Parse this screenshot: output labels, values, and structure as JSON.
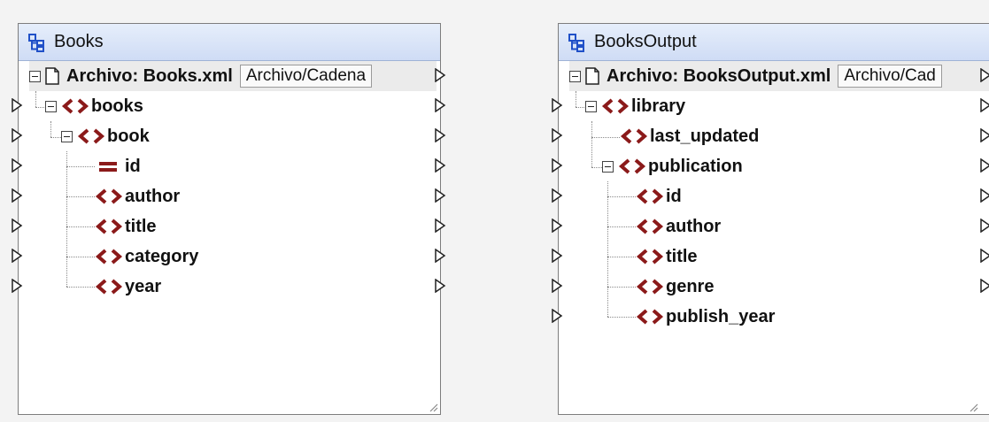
{
  "components": [
    {
      "id": "books",
      "title": "Books",
      "file_label": "Archivo: Books.xml",
      "file_button": "Archivo/Cadena",
      "nodes": [
        "books",
        "book",
        "id",
        "author",
        "title",
        "category",
        "year"
      ]
    },
    {
      "id": "output",
      "title": "BooksOutput",
      "file_label": "Archivo: BooksOutput.xml",
      "file_button": "Archivo/Cad",
      "nodes": [
        "library",
        "last_updated",
        "publication",
        "id",
        "author",
        "title",
        "genre",
        "publish_year"
      ]
    }
  ],
  "icons": {
    "component": "structure-tree-icon",
    "element": "xml-element-icon",
    "attribute": "xml-attribute-icon",
    "file": "document-icon",
    "port": "connector-triangle-icon"
  },
  "colors": {
    "element_icon": "#8b1a1a",
    "header_bg": "#d6e2f7",
    "component_icon": "#2050c8"
  }
}
